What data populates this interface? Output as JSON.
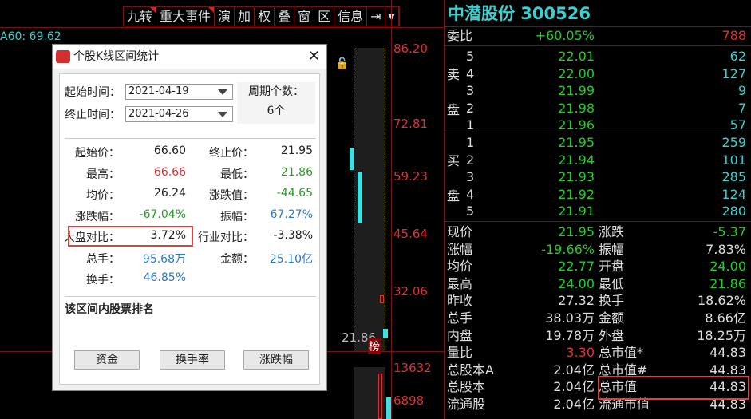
{
  "toolbar": [
    "九转",
    "重大事件",
    "演",
    "加",
    "权",
    "叠",
    "窗",
    "区",
    "信息",
    "⇥",
    "▾"
  ],
  "chart": {
    "ma_label": "A60: 69.62",
    "axis": [
      "86.20",
      "72.81",
      "59.23",
      "45.64",
      "32.06"
    ],
    "low_label": "21.86",
    "rank_badge": "榜",
    "vol_axis": [
      "13632",
      "6898"
    ]
  },
  "dialog": {
    "title": "个股K线区间统计",
    "start_label": "起始时间：",
    "start_value": "2021-04-19",
    "end_label": "终止时间：",
    "end_value": "2021-04-26",
    "period_label": "周期个数：",
    "period_value": "6个",
    "stats": [
      {
        "l": "起始价：",
        "v": "66.60",
        "c": "k",
        "l2": "终止价：",
        "v2": "21.95",
        "c2": "k"
      },
      {
        "l": "最高：",
        "v": "66.66",
        "c": "r",
        "l2": "最低：",
        "v2": "21.86",
        "c2": "g"
      },
      {
        "l": "均价：",
        "v": "26.24",
        "c": "k",
        "l2": "涨跌值：",
        "v2": "-44.65",
        "c2": "g"
      },
      {
        "l": "涨跌幅：",
        "v": "-67.04%",
        "c": "g",
        "l2": "振幅：",
        "v2": "67.27%",
        "c2": "b"
      },
      {
        "l": "大盘对比：",
        "v": "3.72%",
        "c": "k",
        "l2": "行业对比：",
        "v2": "-3.38%",
        "c2": "k"
      },
      {
        "l": "总手：",
        "v": "95.68万",
        "c": "b",
        "l2": "金额：",
        "v2": "25.10亿",
        "c2": "b"
      },
      {
        "l": "换手：",
        "v": "46.85%",
        "c": "b",
        "l2": "",
        "v2": "",
        "c2": "k"
      }
    ],
    "rank_title": "该区间内股票排名",
    "buttons": [
      "资金",
      "换手率",
      "涨跌幅"
    ]
  },
  "quote": {
    "title": "中潜股份 300526",
    "weibi_label": "委比",
    "weibi_pct": "+60.05%",
    "weibi_val": "788",
    "sell_side": [
      "卖",
      "盘"
    ],
    "buy_side": [
      "买",
      "盘"
    ],
    "sell": [
      {
        "n": "5",
        "p": "22.01",
        "v": "62"
      },
      {
        "n": "4",
        "p": "22.00",
        "v": "127"
      },
      {
        "n": "3",
        "p": "21.99",
        "v": "9"
      },
      {
        "n": "2",
        "p": "21.98",
        "v": "7"
      },
      {
        "n": "1",
        "p": "21.96",
        "v": "57"
      }
    ],
    "buy": [
      {
        "n": "1",
        "p": "21.95",
        "v": "259"
      },
      {
        "n": "2",
        "p": "21.94",
        "v": "101"
      },
      {
        "n": "3",
        "p": "21.93",
        "v": "285"
      },
      {
        "n": "4",
        "p": "21.92",
        "v": "124"
      },
      {
        "n": "5",
        "p": "21.91",
        "v": "280"
      }
    ],
    "stats": [
      {
        "l": "现价",
        "v": "21.95",
        "c": "g",
        "l2": "涨跌",
        "v2": "-5.37",
        "c2": "g"
      },
      {
        "l": "涨幅",
        "v": "-19.66%",
        "c": "g",
        "l2": "振幅",
        "v2": "7.83%",
        "c2": "w"
      },
      {
        "l": "均价",
        "v": "22.77",
        "c": "g",
        "l2": "开盘",
        "v2": "24.00",
        "c2": "g"
      },
      {
        "l": "最高",
        "v": "24.00",
        "c": "g",
        "l2": "最低",
        "v2": "21.86",
        "c2": "g"
      },
      {
        "l": "昨收",
        "v": "27.32",
        "c": "w",
        "l2": "换手",
        "v2": "18.62%",
        "c2": "w"
      },
      {
        "l": "总手",
        "v": "38.03万",
        "c": "w",
        "l2": "金额",
        "v2": "8.66亿",
        "c2": "w"
      },
      {
        "l": "内盘",
        "v": "19.78万",
        "c": "w",
        "l2": "外盘",
        "v2": "18.25万",
        "c2": "w"
      },
      {
        "l": "量比",
        "v": "3.30",
        "c": "r",
        "l2": "总市值*",
        "v2": "44.83",
        "c2": "w"
      },
      {
        "l": "总股本A",
        "v": "2.04亿",
        "c": "w",
        "l2": "总市值#",
        "v2": "44.83",
        "c2": "w"
      },
      {
        "l": "总股本",
        "v": "2.04亿",
        "c": "w",
        "l2": "总市值",
        "v2": "44.83",
        "c2": "w"
      },
      {
        "l": "流通股",
        "v": "2.04亿",
        "c": "w",
        "l2": "流通市值",
        "v2": "44.83",
        "c2": "w"
      }
    ]
  }
}
